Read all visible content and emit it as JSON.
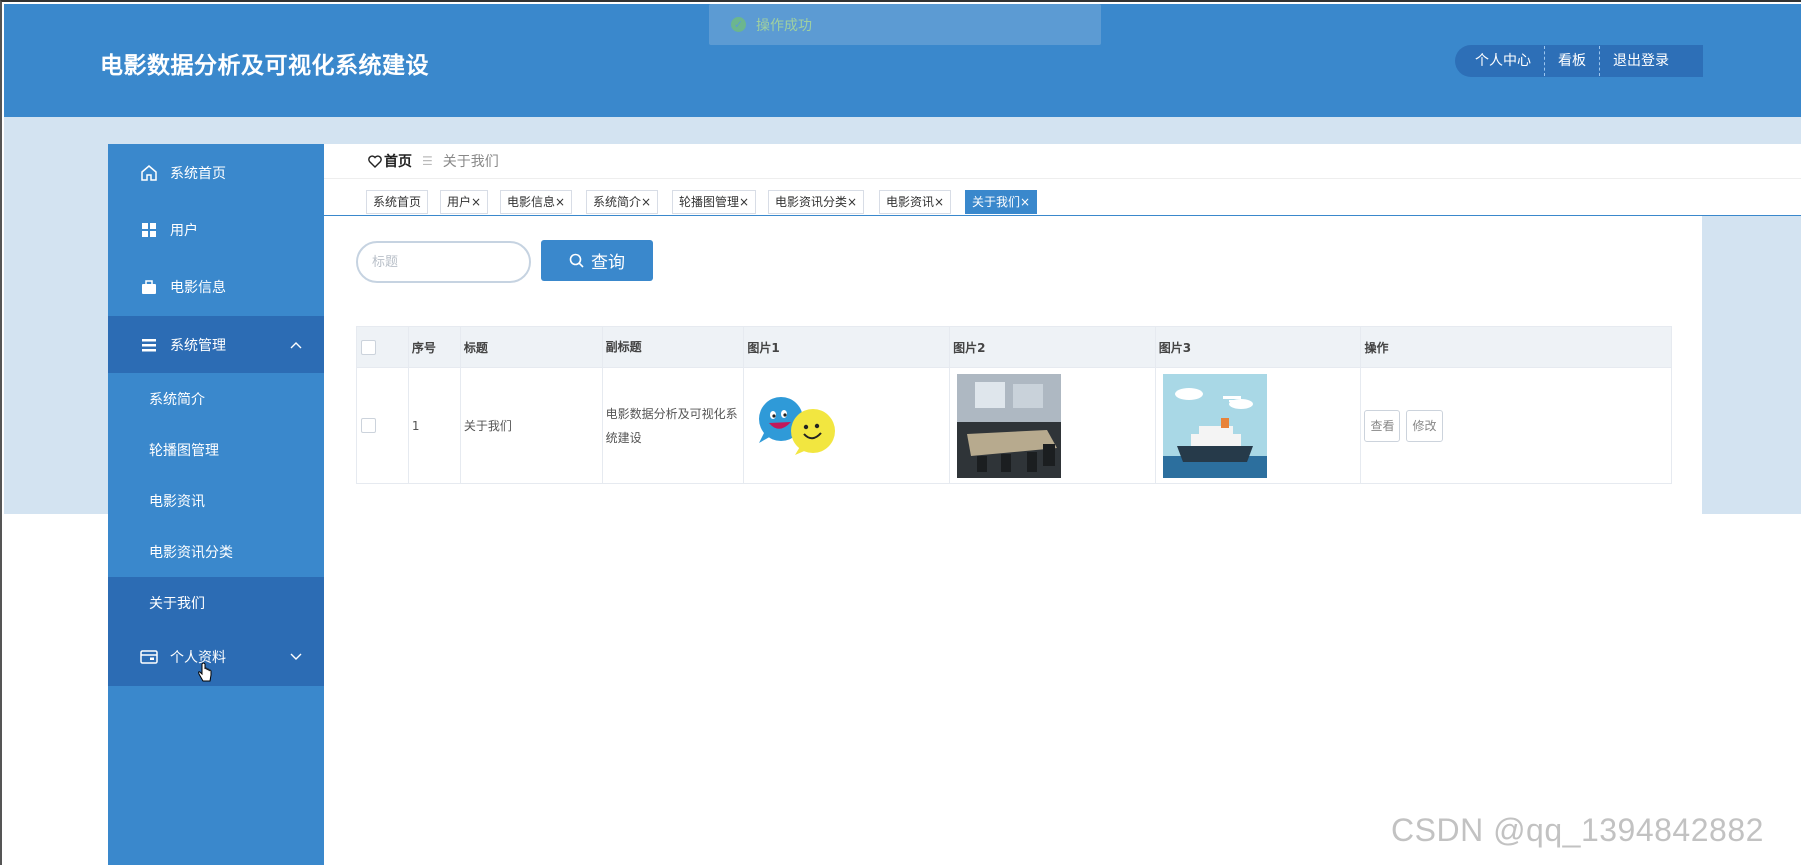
{
  "header": {
    "app_title": "电影数据分析及可视化系统建设",
    "nav": [
      "个人中心",
      "看板",
      "退出登录"
    ],
    "bg_color": "#3a88cc"
  },
  "toast": {
    "text": "操作成功",
    "icon": "check-circle-icon"
  },
  "sidebar": {
    "items": [
      {
        "label": "系统首页",
        "icon": "home-icon"
      },
      {
        "label": "用户",
        "icon": "grid-icon"
      },
      {
        "label": "电影信息",
        "icon": "briefcase-icon"
      },
      {
        "label": "系统管理",
        "icon": "list-icon",
        "expanded": true
      },
      {
        "label": "个人资料",
        "icon": "card-icon",
        "expanded": false
      }
    ],
    "subitems": [
      "系统简介",
      "轮播图管理",
      "电影资讯",
      "电影资讯分类",
      "关于我们"
    ],
    "active_subitem": "关于我们"
  },
  "breadcrumb": {
    "home": "首页",
    "current": "关于我们"
  },
  "tabs": [
    "系统首页",
    "用户",
    "电影信息",
    "系统简介",
    "轮播图管理",
    "电影资讯分类",
    "电影资讯",
    "关于我们"
  ],
  "tab_close": "×",
  "active_tab": "关于我们",
  "search": {
    "placeholder": "标题",
    "button_label": "查询"
  },
  "table": {
    "columns": [
      "序号",
      "标题",
      "副标题",
      "图片1",
      "图片2",
      "图片3",
      "操作"
    ],
    "rows": [
      {
        "index": "1",
        "title": "关于我们",
        "subtitle": "电影数据分析及可视化系统建设",
        "actions": [
          "查看",
          "修改"
        ]
      }
    ]
  },
  "watermark": "CSDN @qq_1394842882"
}
